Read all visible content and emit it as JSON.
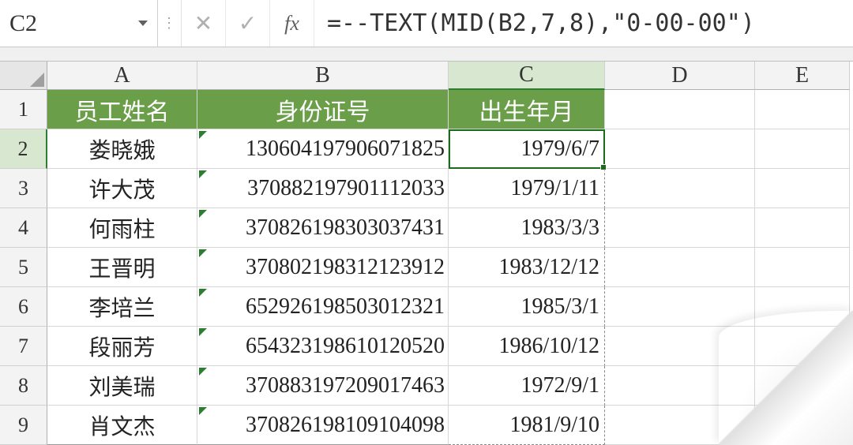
{
  "nameBox": "C2",
  "formula": "=--TEXT(MID(B2,7,8),\"0-00-00\")",
  "columns": [
    "A",
    "B",
    "C",
    "D",
    "E"
  ],
  "activeCol": "C",
  "activeRow": 2,
  "rowNums": [
    1,
    2,
    3,
    4,
    5,
    6,
    7,
    8,
    9
  ],
  "headers": {
    "A": "员工姓名",
    "B": "身份证号",
    "C": "出生年月"
  },
  "rows": [
    {
      "A": "娄晓娥",
      "B": "130604197906071825",
      "C": "1979/6/7"
    },
    {
      "A": "许大茂",
      "B": "370882197901112033",
      "C": "1979/1/11"
    },
    {
      "A": "何雨柱",
      "B": "370826198303037431",
      "C": "1983/3/3"
    },
    {
      "A": "王晋明",
      "B": "370802198312123912",
      "C": "1983/12/12"
    },
    {
      "A": "李培兰",
      "B": "652926198503012321",
      "C": "1985/3/1"
    },
    {
      "A": "段丽芳",
      "B": "654323198610120520",
      "C": "1986/10/12"
    },
    {
      "A": "刘美瑞",
      "B": "370883197209017463",
      "C": "1972/9/1"
    },
    {
      "A": "肖文杰",
      "B": "370826198109104098",
      "C": "1981/9/10"
    }
  ],
  "fbIcons": {
    "cancel": "✕",
    "enter": "✓",
    "fx": "fx",
    "sep": "⋮"
  }
}
